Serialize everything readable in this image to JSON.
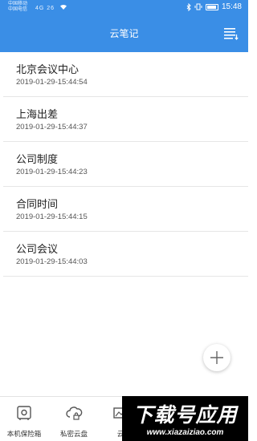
{
  "status_bar": {
    "carrier_line1": "中国移动",
    "carrier_line2": "中国电信",
    "signal_text": "4G 26",
    "time": "15:48"
  },
  "app_bar": {
    "title": "云笔记",
    "menu_icon": "sort-list-icon"
  },
  "notes": [
    {
      "name": "北京会议中心",
      "time": "2019-01-29-15:44:54"
    },
    {
      "name": "上海出差",
      "time": "2019-01-29-15:44:37"
    },
    {
      "name": "公司制度",
      "time": "2019-01-29-15:44:23"
    },
    {
      "name": "合同时间",
      "time": "2019-01-29-15:44:15"
    },
    {
      "name": "公司会议",
      "time": "2019-01-29-15:44:03"
    }
  ],
  "fab": {
    "icon": "plus-icon"
  },
  "bottom_nav": {
    "tabs": [
      {
        "label": "本机保险箱",
        "icon": "safe-icon"
      },
      {
        "label": "私密云盘",
        "icon": "cloud-lock-icon"
      },
      {
        "label": "云",
        "icon": "image-icon"
      }
    ]
  },
  "watermark": {
    "big": "下载号应用",
    "small": "www.xiazaiziao.com"
  },
  "colors": {
    "primary": "#3a8ee6",
    "text": "#222222",
    "subtext": "#555555",
    "divider": "#e6e6e6"
  }
}
